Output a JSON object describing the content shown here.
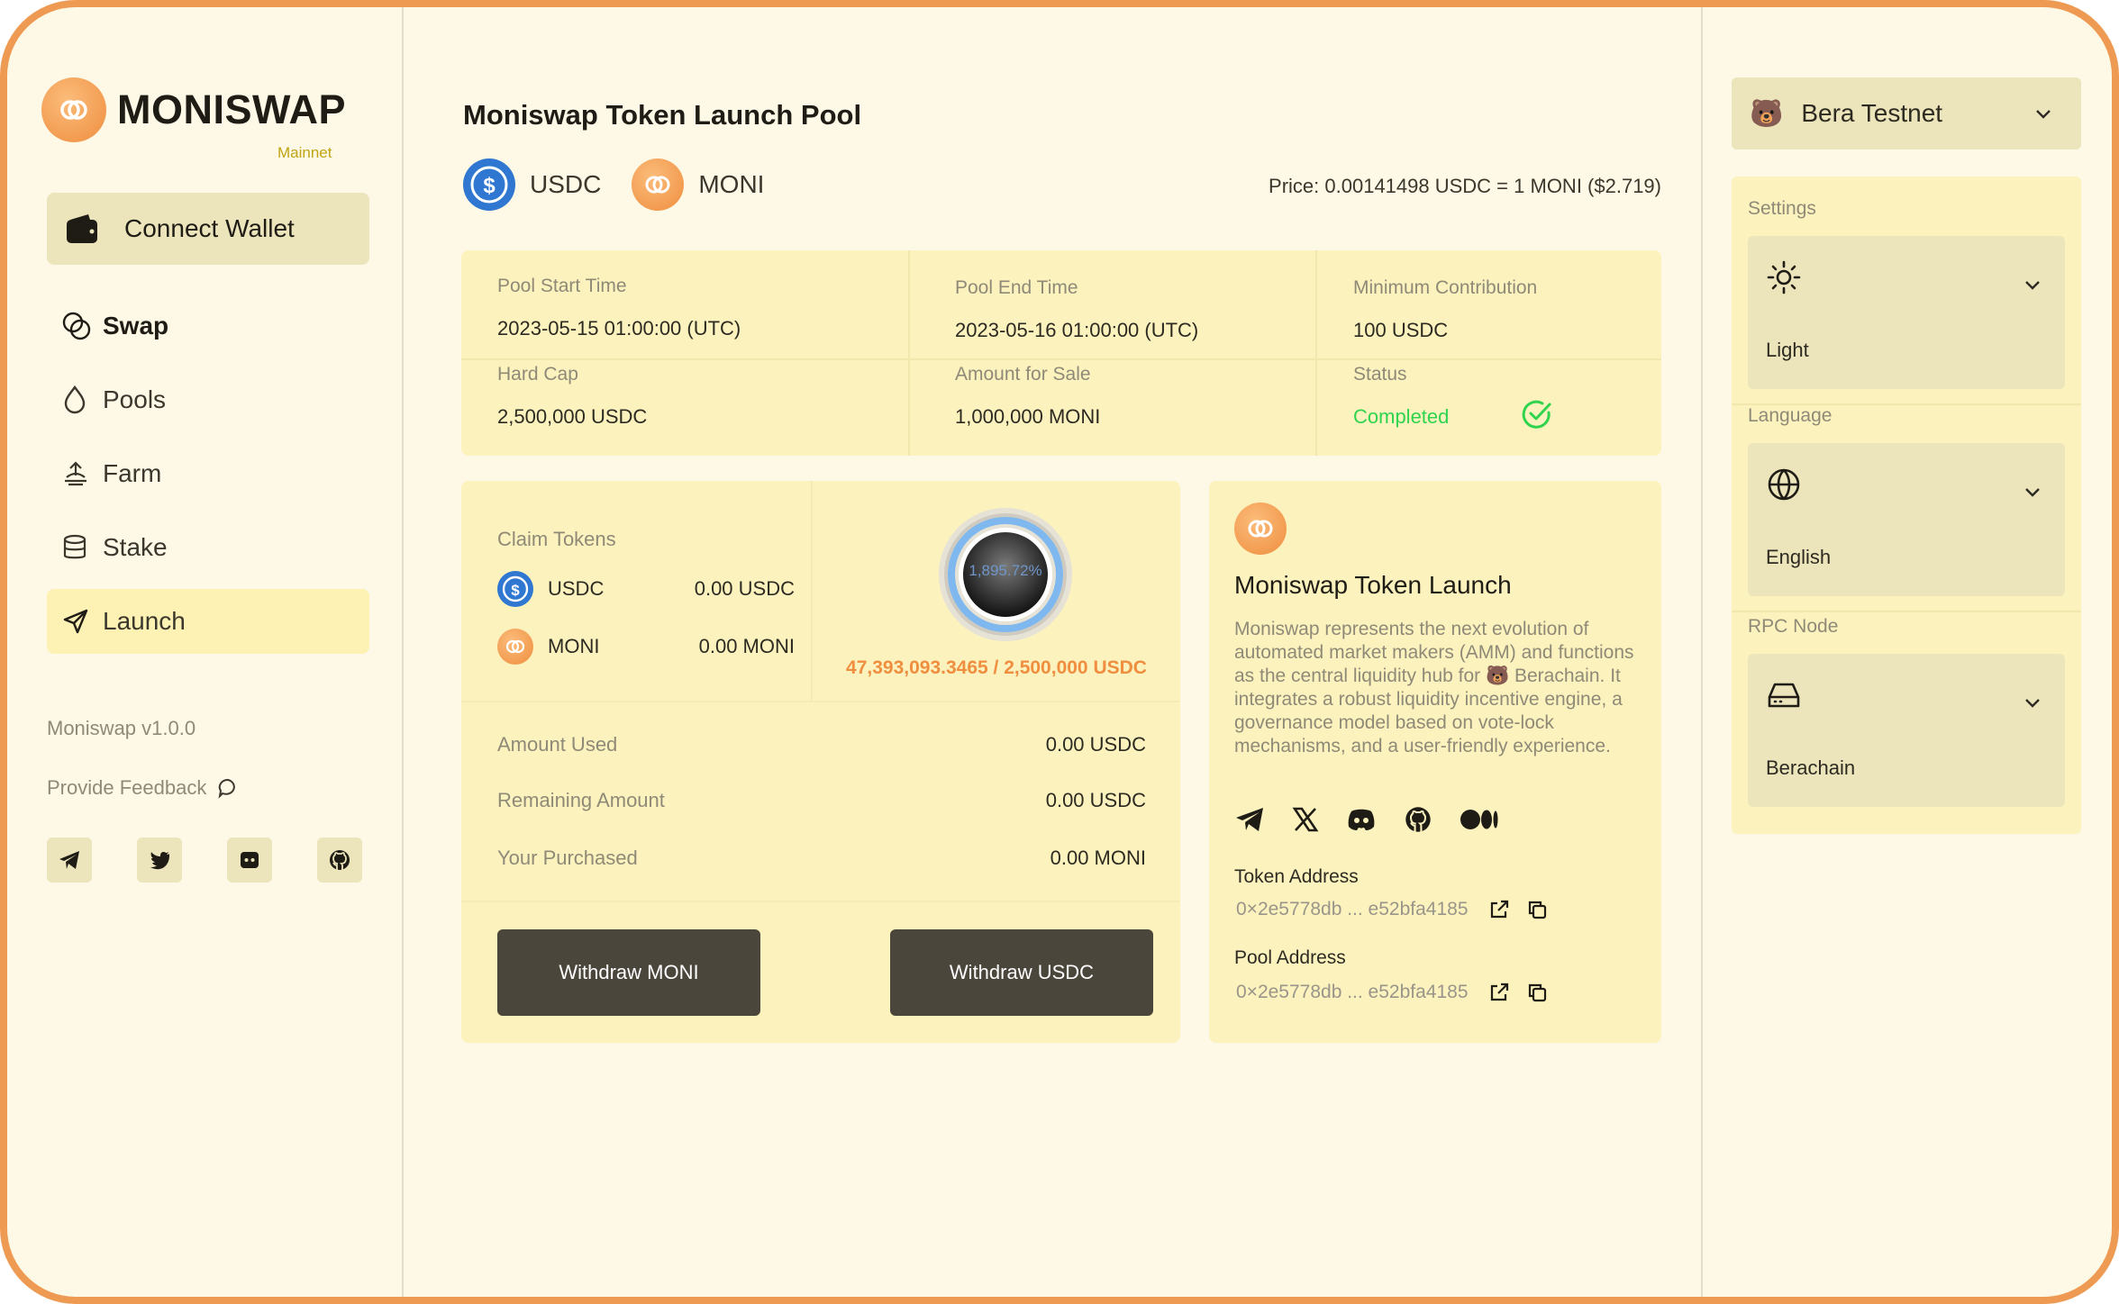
{
  "brand": {
    "name": "MONISWAP",
    "network": "Mainnet"
  },
  "sidebar": {
    "connect_label": "Connect Wallet",
    "nav": [
      {
        "label": "Swap",
        "icon": "swap-icon"
      },
      {
        "label": "Pools",
        "icon": "droplet-icon"
      },
      {
        "label": "Farm",
        "icon": "farm-icon"
      },
      {
        "label": "Stake",
        "icon": "database-icon"
      },
      {
        "label": "Launch",
        "icon": "send-icon"
      }
    ],
    "version": "Moniswap v1.0.0",
    "feedback": "Provide Feedback",
    "socials": [
      "telegram-icon",
      "twitter-icon",
      "discord-icon",
      "github-icon"
    ]
  },
  "main": {
    "title": "Moniswap Token Launch Pool",
    "pair": {
      "base": "USDC",
      "quote": "MONI"
    },
    "price": "Price: 0.00141498 USDC = 1 MONI ($2.719)",
    "info": {
      "pool_start": {
        "label": "Pool Start Time",
        "value": "2023-05-15 01:00:00 (UTC)"
      },
      "pool_end": {
        "label": "Pool End Time",
        "value": "2023-05-16 01:00:00 (UTC)"
      },
      "min_contribution": {
        "label": "Minimum Contribution",
        "value": "100 USDC"
      },
      "hard_cap": {
        "label": "Hard Cap",
        "value": "2,500,000 USDC"
      },
      "amount_for_sale": {
        "label": "Amount for Sale",
        "value": "1,000,000 MONI"
      },
      "status": {
        "label": "Status",
        "value": "Completed"
      }
    },
    "claim": {
      "title": "Claim Tokens",
      "usdc": {
        "name": "USDC",
        "amount": "0.00 USDC"
      },
      "moni": {
        "name": "MONI",
        "amount": "0.00 MONI"
      },
      "progress_percent": "1,895.72%",
      "raised": "47,393,093.3465 / 2,500,000 USDC",
      "amount_used": {
        "label": "Amount Used",
        "value": "0.00 USDC"
      },
      "remaining": {
        "label": "Remaining Amount",
        "value": "0.00 USDC"
      },
      "purchased": {
        "label": "Your Purchased",
        "value": "0.00 MONI"
      },
      "withdraw_moni": "Withdraw MONI",
      "withdraw_usdc": "Withdraw USDC"
    },
    "about": {
      "title": "Moniswap Token Launch",
      "description": "Moniswap represents the next evolution of automated market makers (AMM) and functions as the central liquidity hub for 🐻 Berachain. It integrates a robust liquidity incentive engine, a governance model based on vote-lock mechanisms, and a user-friendly experience.",
      "socials": [
        "telegram-icon",
        "x-icon",
        "discord-icon",
        "github-icon",
        "medium-icon"
      ],
      "token_address_label": "Token Address",
      "token_address": "0×2e5778db ... e52bfa4185",
      "pool_address_label": "Pool Address",
      "pool_address": "0×2e5778db ... e52bfa4185"
    }
  },
  "rightbar": {
    "network": "Bera Testnet",
    "network_icon": "🐻",
    "settings_label": "Settings",
    "theme": "Light",
    "language_label": "Language",
    "language": "English",
    "rpc_label": "RPC Node",
    "rpc": "Berachain"
  },
  "colors": {
    "accent": "#ef8e3f",
    "panel": "#fcf2bd",
    "success": "#2fd34e",
    "usdc": "#2f77d0"
  }
}
